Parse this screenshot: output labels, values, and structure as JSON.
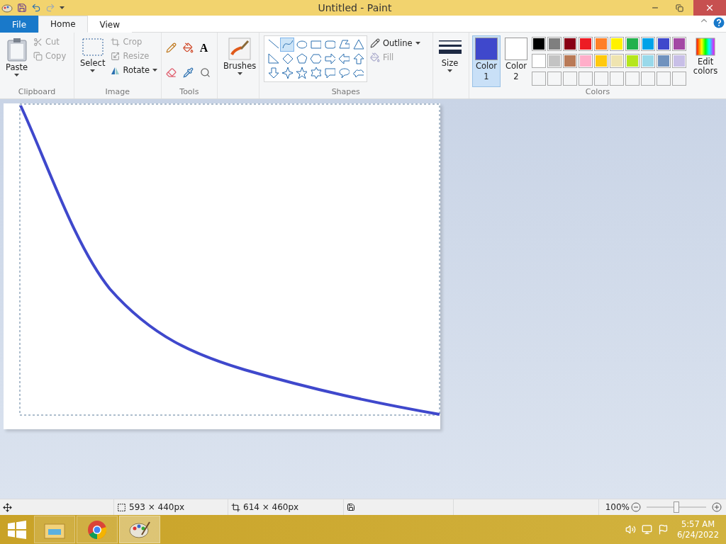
{
  "window": {
    "title": "Untitled - Paint"
  },
  "tabs": [
    {
      "label": "File",
      "kind": "file",
      "selected": false
    },
    {
      "label": "Home",
      "kind": "tab",
      "selected": true
    },
    {
      "label": "View",
      "kind": "tab",
      "selected": false
    }
  ],
  "clipboard": {
    "paste": "Paste",
    "cut": "Cut",
    "copy": "Copy",
    "label": "Clipboard",
    "cut_disabled": true,
    "copy_disabled": true
  },
  "image": {
    "select": "Select",
    "crop": "Crop",
    "resize": "Resize",
    "rotate": "Rotate",
    "label": "Image",
    "crop_disabled": true
  },
  "tools": {
    "label": "Tools",
    "text_tool": "A"
  },
  "brushes": {
    "label": "Brushes"
  },
  "shapes": {
    "label": "Shapes",
    "items": [
      {
        "kind": "line",
        "selected": false
      },
      {
        "kind": "curve",
        "selected": true
      },
      {
        "kind": "oval",
        "selected": false
      },
      {
        "kind": "rectangle",
        "selected": false
      },
      {
        "kind": "rounded",
        "selected": false
      },
      {
        "kind": "polygon",
        "selected": false
      },
      {
        "kind": "triangle",
        "selected": false
      },
      {
        "kind": "right-triangle",
        "selected": false
      },
      {
        "kind": "diamond",
        "selected": false
      },
      {
        "kind": "pentagon",
        "selected": false
      },
      {
        "kind": "hexagon",
        "selected": false
      },
      {
        "kind": "arrow-right",
        "selected": false
      },
      {
        "kind": "arrow-left",
        "selected": false
      },
      {
        "kind": "arrow-up",
        "selected": false
      },
      {
        "kind": "arrow-down",
        "selected": false
      },
      {
        "kind": "star4",
        "selected": false
      },
      {
        "kind": "star5",
        "selected": false
      },
      {
        "kind": "star6",
        "selected": false
      },
      {
        "kind": "callout-rect",
        "selected": false
      },
      {
        "kind": "callout-oval",
        "selected": false
      },
      {
        "kind": "callout-cloud",
        "selected": false
      }
    ],
    "outline": "Outline",
    "fill": "Fill",
    "fill_disabled": true
  },
  "size": {
    "label": "Size"
  },
  "colors": {
    "label": "Colors",
    "color1": {
      "label1": "Color",
      "label2": "1",
      "color": "#3f48cc",
      "selected": true
    },
    "color2": {
      "label1": "Color",
      "label2": "2",
      "color": "#ffffff",
      "selected": false
    },
    "edit": "Edit colors",
    "palette": [
      {
        "color": "#000000"
      },
      {
        "color": "#7f7f7f"
      },
      {
        "color": "#880015"
      },
      {
        "color": "#ed1c24"
      },
      {
        "color": "#ff7f27"
      },
      {
        "color": "#fff200"
      },
      {
        "color": "#22b14c"
      },
      {
        "color": "#00a2e8"
      },
      {
        "color": "#3f48cc"
      },
      {
        "color": "#a349a4"
      },
      {
        "color": "#ffffff"
      },
      {
        "color": "#c3c3c3"
      },
      {
        "color": "#b97a57"
      },
      {
        "color": "#ffaec9"
      },
      {
        "color": "#ffc90e"
      },
      {
        "color": "#efe4b0"
      },
      {
        "color": "#b5e61d"
      },
      {
        "color": "#99d9ea"
      },
      {
        "color": "#7092be"
      },
      {
        "color": "#c8bfe7"
      },
      {
        "kind": "empty"
      },
      {
        "kind": "empty"
      },
      {
        "kind": "empty"
      },
      {
        "kind": "empty"
      },
      {
        "kind": "empty"
      },
      {
        "kind": "empty"
      },
      {
        "kind": "empty"
      },
      {
        "kind": "empty"
      },
      {
        "kind": "empty"
      },
      {
        "kind": "empty"
      }
    ]
  },
  "status_bar": {
    "selection_size": "593 × 440px",
    "image_size": "614 × 460px",
    "zoom_text": "100%",
    "zoom": {
      "level": 0.5
    }
  },
  "taskbar": {
    "apps": [
      {
        "kind": "explorer",
        "selected": false
      },
      {
        "kind": "chrome",
        "selected": false
      },
      {
        "kind": "paint",
        "selected": true
      }
    ],
    "time": "5:57 AM",
    "date": "6/24/2022"
  }
}
